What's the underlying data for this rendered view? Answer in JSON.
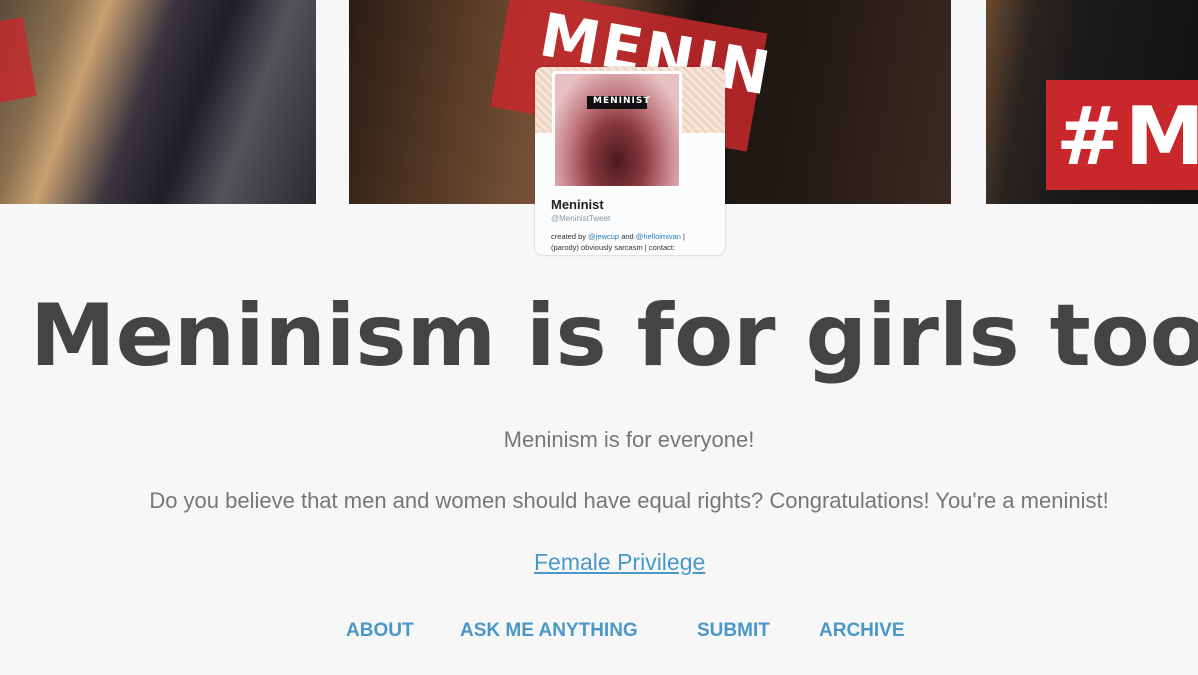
{
  "header": {
    "images": [
      {
        "band_text": ""
      },
      {
        "band_text": "MENIN"
      },
      {
        "band_text": "#M"
      }
    ],
    "profile_card": {
      "avatar_text": "MENINIST",
      "name": "Meninist",
      "handle": "@MeninistTweet",
      "bio_prefix": "created by",
      "bio_link_1": "@jewcup",
      "bio_and": "and",
      "bio_link_2": "@helloimivan",
      "bio_suffix": "|",
      "bio_line_2": "(parody) obviously sarcasm | contact:"
    }
  },
  "main": {
    "title": "Meninism is for girls too!",
    "tagline": "Meninism is for everyone!",
    "question": "Do you believe that men and women should have equal rights? Congratulations! You're a meninist!",
    "link": "Female Privilege"
  },
  "nav": {
    "items": [
      "ABOUT",
      "ASK ME ANYTHING",
      "SUBMIT",
      "ARCHIVE"
    ]
  },
  "colors": {
    "background": "#f7f7f7",
    "title": "#444444",
    "body_text": "#777777",
    "link": "#4a98c9",
    "band_red": "#c8282c"
  }
}
